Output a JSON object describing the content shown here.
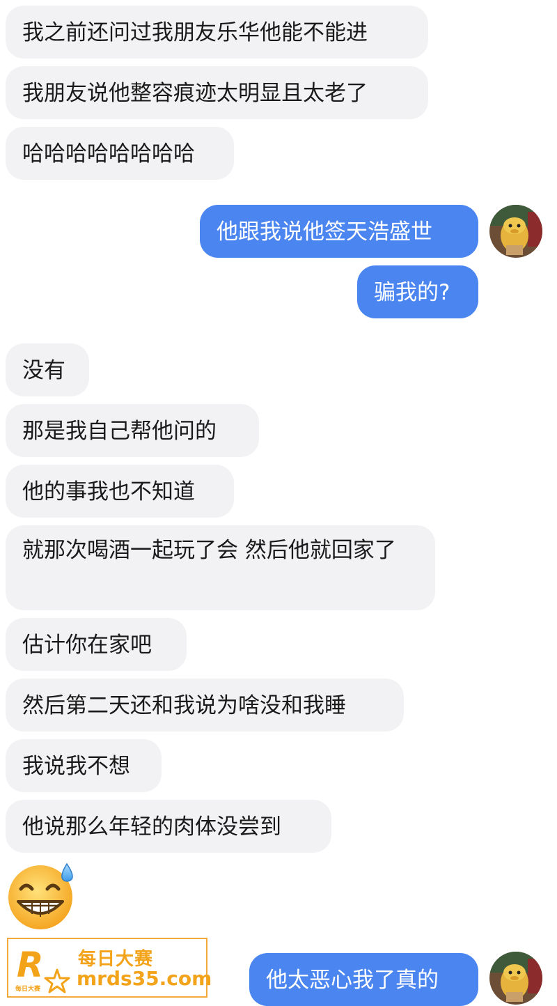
{
  "conversation": {
    "messages": [
      {
        "side": "incoming",
        "text": "我之前还问过我朋友乐华他能不能进"
      },
      {
        "side": "incoming",
        "text": "我朋友说他整容痕迹太明显且太老了"
      },
      {
        "side": "incoming",
        "text": "哈哈哈哈哈哈哈哈"
      },
      {
        "side": "outgoing",
        "text": "他跟我说他签天浩盛世"
      },
      {
        "side": "outgoing",
        "text": "骗我的?"
      },
      {
        "side": "incoming",
        "text": "没有"
      },
      {
        "side": "incoming",
        "text": "那是我自己帮他问的"
      },
      {
        "side": "incoming",
        "text": "他的事我也不知道"
      },
      {
        "side": "incoming",
        "text": "就那次喝酒一起玩了会 然后他就回家了"
      },
      {
        "side": "incoming",
        "text": "估计你在家吧"
      },
      {
        "side": "incoming",
        "text": "然后第二天还和我说为啥没和我睡"
      },
      {
        "side": "incoming",
        "text": "我说我不想"
      },
      {
        "side": "incoming",
        "text": "他说那么年轻的肉体没尝到"
      },
      {
        "side": "incoming",
        "emoji": "sweat-grin-emoji"
      },
      {
        "side": "outgoing",
        "text": "他太恶心我了真的"
      }
    ]
  },
  "watermark": {
    "logo_letter": "R",
    "logo_small_text": "每日大赛",
    "title": "每日大赛",
    "url": "mrds35.com"
  },
  "colors": {
    "incoming_bubble": "#f2f2f4",
    "outgoing_bubble": "#4b86f0",
    "watermark_accent": "#f3a319"
  }
}
